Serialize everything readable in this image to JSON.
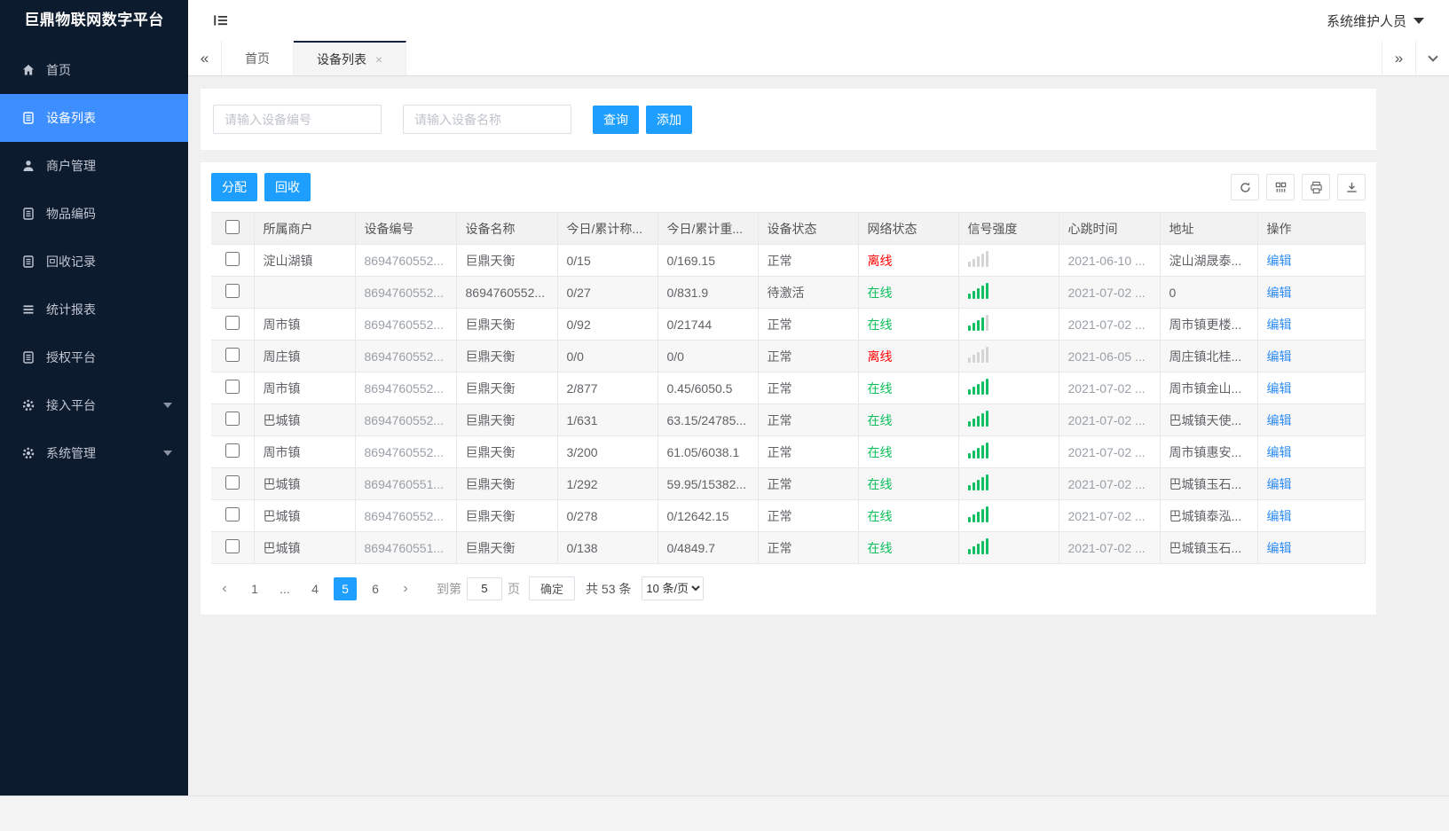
{
  "app": {
    "title": "巨鼎物联网数字平台",
    "user": "系统维护人员"
  },
  "sidebar": {
    "items": [
      {
        "icon": "home-icon",
        "label": "首页",
        "active": false
      },
      {
        "icon": "list-icon",
        "label": "设备列表",
        "active": true
      },
      {
        "icon": "user-icon",
        "label": "商户管理",
        "active": false
      },
      {
        "icon": "doc-icon",
        "label": "物品编码",
        "active": false
      },
      {
        "icon": "doc-icon",
        "label": "回收记录",
        "active": false
      },
      {
        "icon": "report-icon",
        "label": "统计报表",
        "active": false
      },
      {
        "icon": "doc-icon",
        "label": "授权平台",
        "active": false
      },
      {
        "icon": "gear-icon",
        "label": "接入平台",
        "active": false,
        "expandable": true
      },
      {
        "icon": "gear-icon",
        "label": "系统管理",
        "active": false,
        "expandable": true
      }
    ]
  },
  "tabs": {
    "items": [
      {
        "label": "首页",
        "active": false
      },
      {
        "label": "设备列表",
        "active": true,
        "closable": true
      }
    ]
  },
  "search": {
    "device_no_placeholder": "请输入设备编号",
    "device_name_placeholder": "请输入设备名称",
    "query_label": "查询",
    "add_label": "添加"
  },
  "toolbar": {
    "assign_label": "分配",
    "recycle_label": "回收",
    "icons": [
      "refresh-icon",
      "columns-icon",
      "print-icon",
      "export-icon"
    ]
  },
  "table": {
    "edit_label": "编辑",
    "columns": [
      "",
      "所属商户",
      "设备编号",
      "设备名称",
      "今日/累计称...",
      "今日/累计重...",
      "设备状态",
      "网络状态",
      "信号强度",
      "心跳时间",
      "地址",
      "操作"
    ],
    "rows": [
      {
        "merchant": "淀山湖镇",
        "device_no": "8694760552...",
        "device_name": "巨鼎天衡",
        "today_count": "0/15",
        "today_weight": "0/169.15",
        "status": "正常",
        "network": "离线",
        "signal_level": 0,
        "heartbeat": "2021-06-10 ...",
        "address": "淀山湖晟泰..."
      },
      {
        "merchant": "",
        "device_no": "8694760552...",
        "device_name": "8694760552...",
        "today_count": "0/27",
        "today_weight": "0/831.9",
        "status": "待激活",
        "network": "在线",
        "signal_level": 5,
        "heartbeat": "2021-07-02 ...",
        "address": "0"
      },
      {
        "merchant": "周市镇",
        "device_no": "8694760552...",
        "device_name": "巨鼎天衡",
        "today_count": "0/92",
        "today_weight": "0/21744",
        "status": "正常",
        "network": "在线",
        "signal_level": 4,
        "heartbeat": "2021-07-02 ...",
        "address": "周市镇更楼..."
      },
      {
        "merchant": "周庄镇",
        "device_no": "8694760552...",
        "device_name": "巨鼎天衡",
        "today_count": "0/0",
        "today_weight": "0/0",
        "status": "正常",
        "network": "离线",
        "signal_level": 0,
        "heartbeat": "2021-06-05 ...",
        "address": "周庄镇北桂..."
      },
      {
        "merchant": "周市镇",
        "device_no": "8694760552...",
        "device_name": "巨鼎天衡",
        "today_count": "2/877",
        "today_weight": "0.45/6050.5",
        "status": "正常",
        "network": "在线",
        "signal_level": 5,
        "heartbeat": "2021-07-02 ...",
        "address": "周市镇金山..."
      },
      {
        "merchant": "巴城镇",
        "device_no": "8694760552...",
        "device_name": "巨鼎天衡",
        "today_count": "1/631",
        "today_weight": "63.15/24785...",
        "status": "正常",
        "network": "在线",
        "signal_level": 5,
        "heartbeat": "2021-07-02 ...",
        "address": "巴城镇天使..."
      },
      {
        "merchant": "周市镇",
        "device_no": "8694760552...",
        "device_name": "巨鼎天衡",
        "today_count": "3/200",
        "today_weight": "61.05/6038.1",
        "status": "正常",
        "network": "在线",
        "signal_level": 5,
        "heartbeat": "2021-07-02 ...",
        "address": "周市镇惠安..."
      },
      {
        "merchant": "巴城镇",
        "device_no": "8694760551...",
        "device_name": "巨鼎天衡",
        "today_count": "1/292",
        "today_weight": "59.95/15382...",
        "status": "正常",
        "network": "在线",
        "signal_level": 5,
        "heartbeat": "2021-07-02 ...",
        "address": "巴城镇玉石..."
      },
      {
        "merchant": "巴城镇",
        "device_no": "8694760552...",
        "device_name": "巨鼎天衡",
        "today_count": "0/278",
        "today_weight": "0/12642.15",
        "status": "正常",
        "network": "在线",
        "signal_level": 5,
        "heartbeat": "2021-07-02 ...",
        "address": "巴城镇泰泓..."
      },
      {
        "merchant": "巴城镇",
        "device_no": "8694760551...",
        "device_name": "巨鼎天衡",
        "today_count": "0/138",
        "today_weight": "0/4849.7",
        "status": "正常",
        "network": "在线",
        "signal_level": 5,
        "heartbeat": "2021-07-02 ...",
        "address": "巴城镇玉石..."
      }
    ]
  },
  "pagination": {
    "prev": "‹",
    "next": "›",
    "pages": [
      "1",
      "...",
      "4",
      "5",
      "6"
    ],
    "current": "5",
    "goto_label": "到第",
    "goto_value": "5",
    "page_unit": "页",
    "confirm_label": "确定",
    "total_text": "共 53 条",
    "page_size": "10 条/页"
  },
  "colors": {
    "sidebar_bg": "#0d1b2e",
    "active_blue": "#3d8eff",
    "button_blue": "#1e9fff",
    "online_green": "#0abf5b",
    "offline_red": "#fe0000",
    "link_blue": "#2d8cf0"
  }
}
